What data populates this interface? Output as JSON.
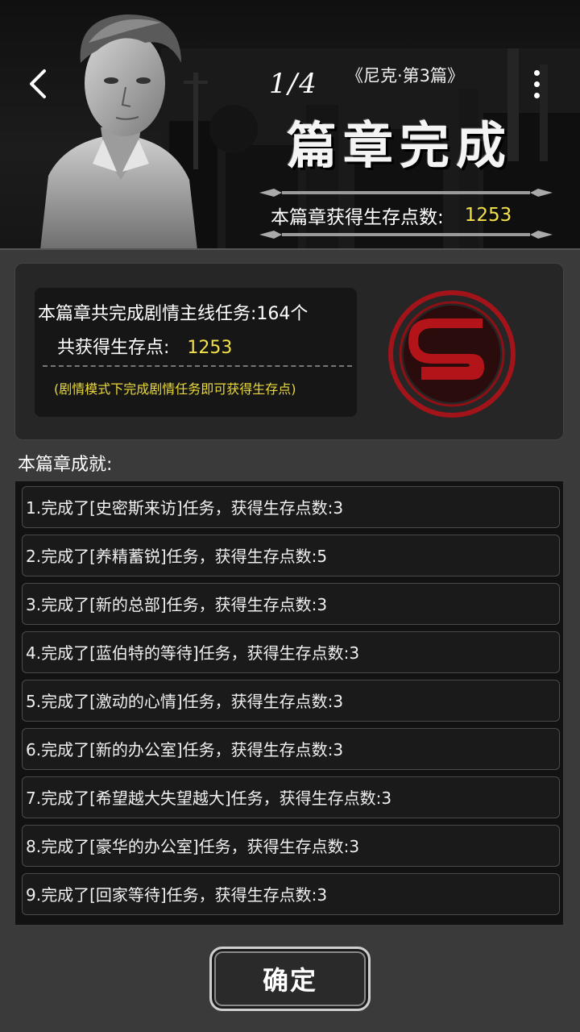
{
  "header": {
    "page_count": "1/4",
    "chapter_name": "《尼克·第3篇》",
    "title": "篇章完成",
    "points_label": "本篇章获得生存点数:",
    "points_value": "1253"
  },
  "summary": {
    "tasks_text": "本篇章共完成剧情主线任务:164个",
    "points_label": "共获得生存点:",
    "points_value": "1253",
    "note": "(剧情模式下完成剧情任务即可获得生存点)"
  },
  "achievements": {
    "title": "本篇章成就:",
    "items": [
      "1.完成了[史密斯来访]任务，获得生存点数:3",
      "2.完成了[养精蓄锐]任务，获得生存点数:5",
      "3.完成了[新的总部]任务，获得生存点数:3",
      "4.完成了[蓝伯特的等待]任务，获得生存点数:3",
      "5.完成了[激动的心情]任务，获得生存点数:3",
      "6.完成了[新的办公室]任务，获得生存点数:3",
      "7.完成了[希望越大失望越大]任务，获得生存点数:3",
      "8.完成了[豪华的办公室]任务，获得生存点数:3",
      "9.完成了[回家等待]任务，获得生存点数:3"
    ]
  },
  "confirm_label": "确定",
  "colors": {
    "accent_yellow": "#f3e14a",
    "emblem_red": "#b3141a"
  },
  "icons": [
    "back-arrow-icon",
    "more-vertical-icon",
    "survival-emblem-icon"
  ]
}
